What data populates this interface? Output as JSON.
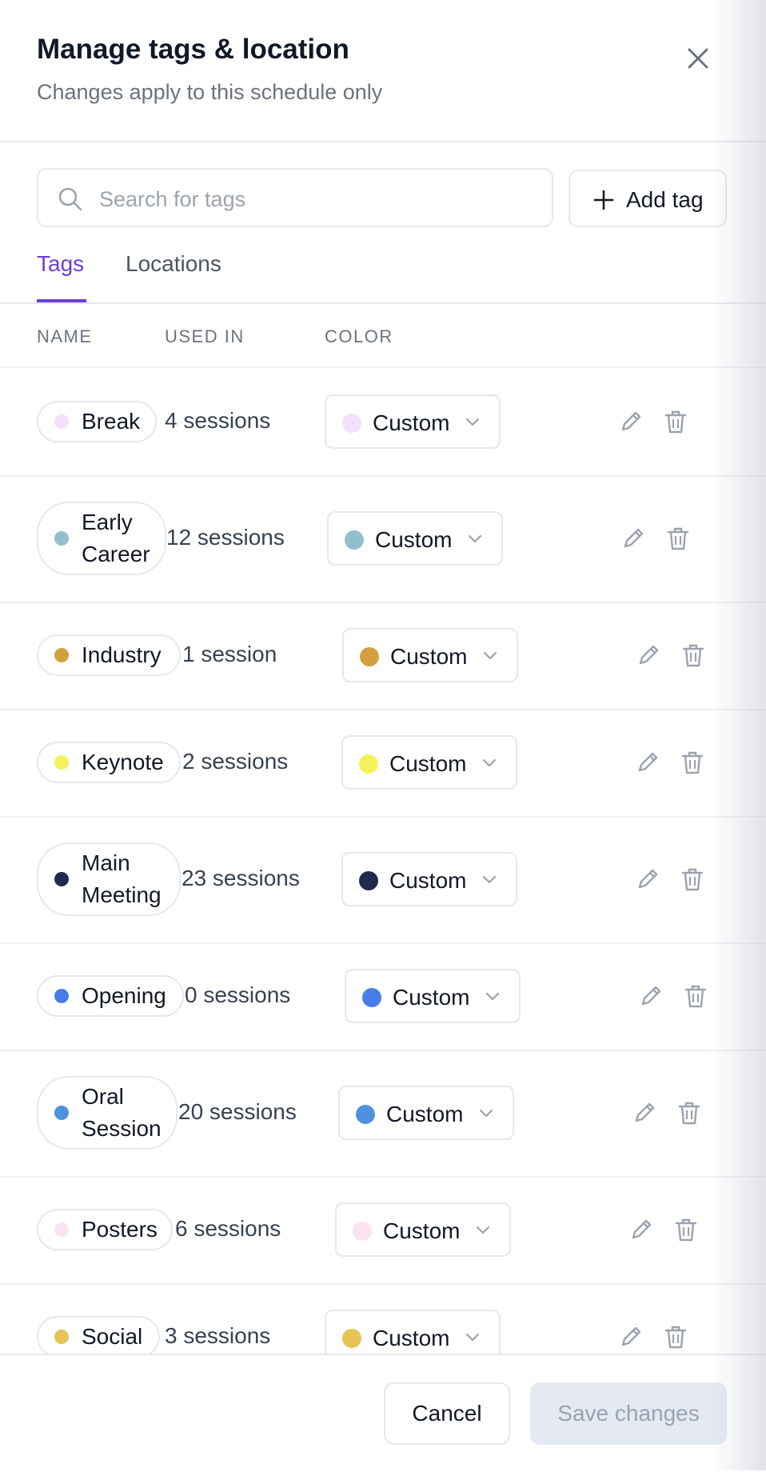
{
  "modal": {
    "title": "Manage tags & location",
    "subtitle": "Changes apply to this schedule only",
    "close_icon": "close-icon"
  },
  "search": {
    "placeholder": "Search for tags",
    "value": "",
    "icon": "search-icon"
  },
  "add_tag": {
    "label": "Add tag",
    "icon": "plus-icon"
  },
  "tabs": [
    {
      "label": "Tags",
      "active": true
    },
    {
      "label": "Locations",
      "active": false
    }
  ],
  "columns": {
    "name": "NAME",
    "used_in": "USED IN",
    "color": "COLOR"
  },
  "tags": [
    {
      "name": "Break",
      "used_in": "4 sessions",
      "color_mode": "Custom",
      "color": "#f3e0fb"
    },
    {
      "name": "Early\nCareer",
      "used_in": "12 sessions",
      "color_mode": "Custom",
      "color": "#92bfcd"
    },
    {
      "name": "Industry",
      "used_in": "1 session",
      "color_mode": "Custom",
      "color": "#d2a03f"
    },
    {
      "name": "Keynote",
      "used_in": "2 sessions",
      "color_mode": "Custom",
      "color": "#f4f15a"
    },
    {
      "name": "Main\nMeeting",
      "used_in": "23 sessions",
      "color_mode": "Custom",
      "color": "#1e2b4f"
    },
    {
      "name": "Opening",
      "used_in": "0 sessions",
      "color_mode": "Custom",
      "color": "#467ee8"
    },
    {
      "name": "Oral\nSession",
      "used_in": "20 sessions",
      "color_mode": "Custom",
      "color": "#5091de"
    },
    {
      "name": "Posters",
      "used_in": "6 sessions",
      "color_mode": "Custom",
      "color": "#fbe2f3"
    },
    {
      "name": "Social",
      "used_in": "3 sessions",
      "color_mode": "Custom",
      "color": "#e6c355"
    }
  ],
  "row_icons": {
    "edit": "pencil-icon",
    "delete": "trash-icon"
  },
  "footer": {
    "cancel_label": "Cancel",
    "save_label": "Save changes"
  }
}
